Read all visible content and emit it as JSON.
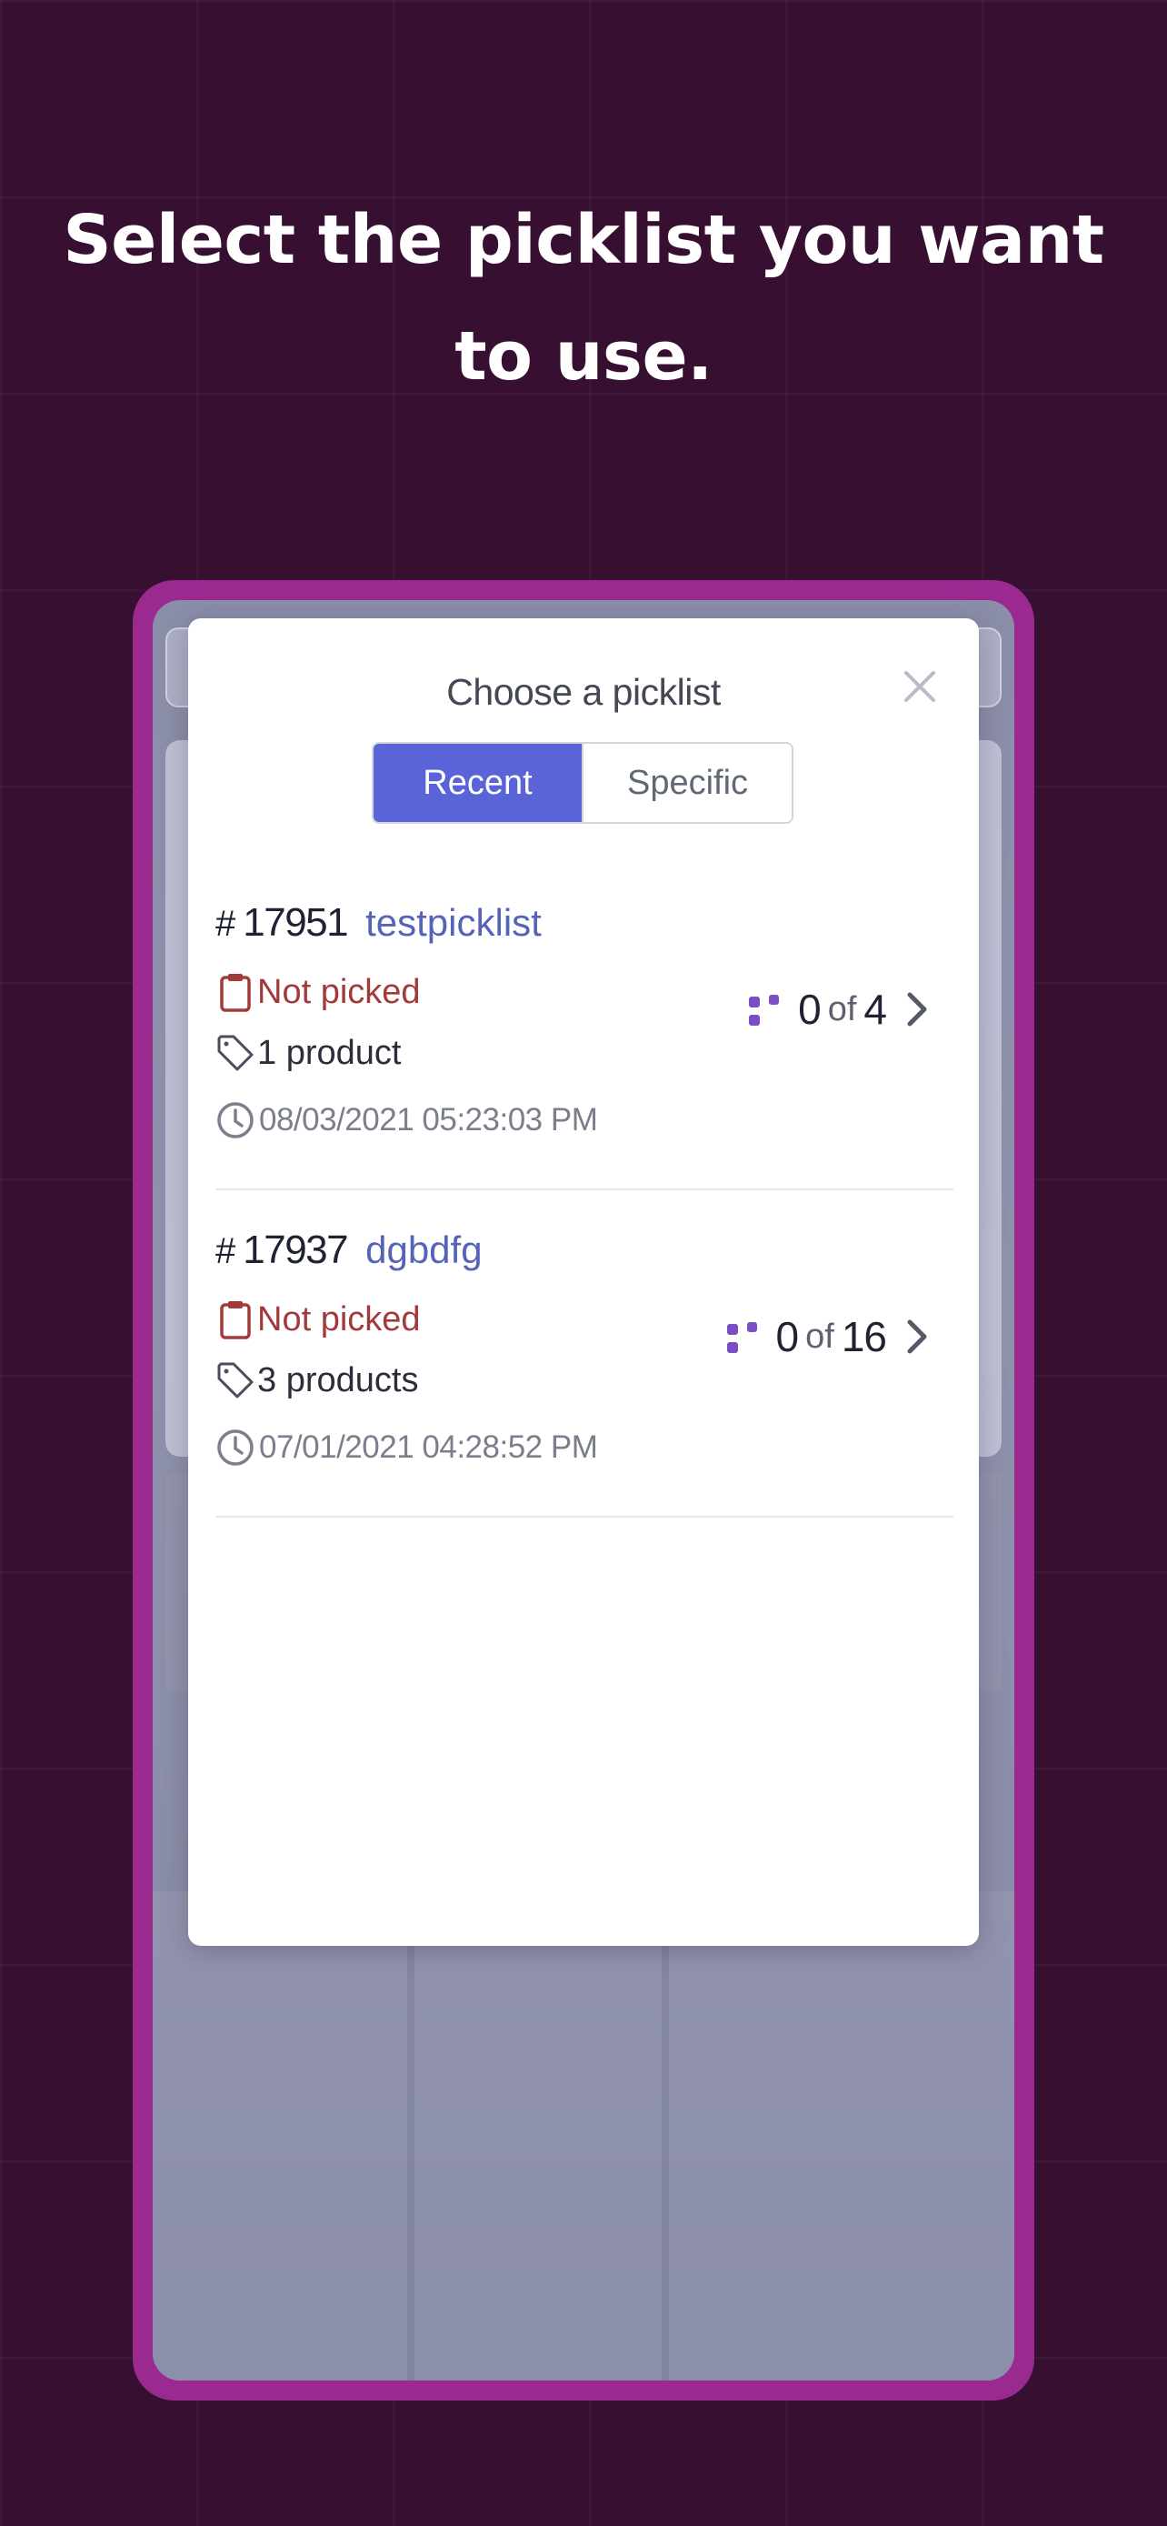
{
  "headline": "Select the picklist you want to use.",
  "modal": {
    "title": "Choose a picklist",
    "tabs": [
      {
        "label": "Recent",
        "active": true
      },
      {
        "label": "Specific",
        "active": false
      }
    ]
  },
  "picklists": [
    {
      "hash": "#",
      "number": "17951",
      "name": "testpicklist",
      "status": "Not picked",
      "products": "1 product",
      "date": "08/03/2021 05:23:03 PM",
      "picked": "0",
      "of": "of",
      "total": "4"
    },
    {
      "hash": "#",
      "number": "17937",
      "name": "dgbdfg",
      "status": "Not picked",
      "products": "3 products",
      "date": "07/01/2021 04:28:52 PM",
      "picked": "0",
      "of": "of",
      "total": "16"
    }
  ],
  "colors": {
    "background": "#371031",
    "frame": "#9a2a8f",
    "accent": "#5b63d8",
    "status_not_picked": "#a33a3a",
    "picklist_name": "#5563b8",
    "progress_icon": "#7a4fc4"
  },
  "icons": {
    "close": "close-icon",
    "status": "clipboard-icon",
    "products": "tag-icon",
    "date": "clock-icon",
    "progress": "dots-grid-icon",
    "open": "chevron-right-icon"
  }
}
